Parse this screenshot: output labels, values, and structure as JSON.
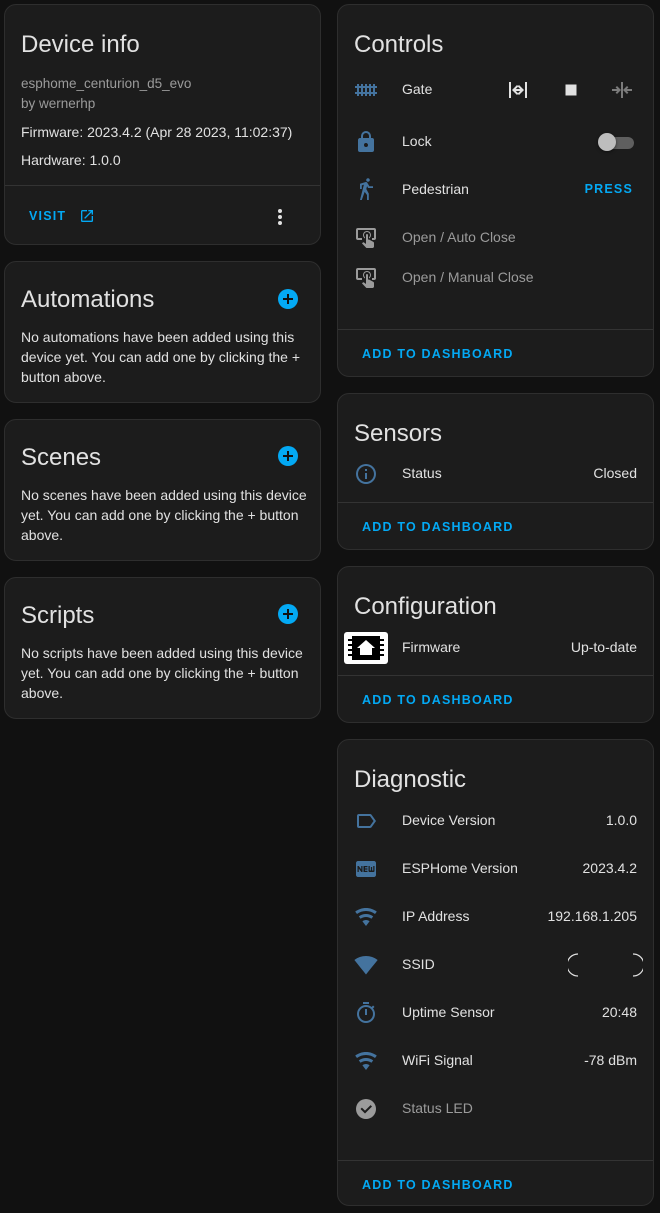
{
  "colors": {
    "accent": "#03a9f4",
    "state_icon": "#44739e",
    "background": "#111111",
    "card": "#1c1c1c"
  },
  "device_info": {
    "title": "Device info",
    "name": "esphome_centurion_d5_evo",
    "manufacturer": "by wernerhp",
    "firmware": "Firmware: 2023.4.2 (Apr 28 2023, 11:02:37)",
    "hardware": "Hardware: 1.0.0",
    "visit_label": "VISIT"
  },
  "automations": {
    "title": "Automations",
    "description": "No automations have been added using this device yet. You can add one by clicking the + button above."
  },
  "scenes": {
    "title": "Scenes",
    "description": "No scenes have been added using this device yet. You can add one by clicking the + button above."
  },
  "scripts": {
    "title": "Scripts",
    "description": "No scripts have been added using this device yet. You can add one by clicking the + button above."
  },
  "controls": {
    "title": "Controls",
    "gate_label": "Gate",
    "lock_label": "Lock",
    "lock_state": "off",
    "pedestrian_label": "Pedestrian",
    "pedestrian_action": "PRESS",
    "open_auto_close": "Open / Auto Close",
    "open_manual_close": "Open / Manual Close",
    "add_to_dashboard": "ADD TO DASHBOARD"
  },
  "sensors": {
    "title": "Sensors",
    "status_label": "Status",
    "status_value": "Closed",
    "add_to_dashboard": "ADD TO DASHBOARD"
  },
  "configuration": {
    "title": "Configuration",
    "firmware_label": "Firmware",
    "firmware_value": "Up-to-date",
    "add_to_dashboard": "ADD TO DASHBOARD"
  },
  "diagnostic": {
    "title": "Diagnostic",
    "rows": [
      {
        "label": "Device Version",
        "value": "1.0.0",
        "icon": "tag-icon"
      },
      {
        "label": "ESPHome Version",
        "value": "2023.4.2",
        "icon": "new-badge-icon"
      },
      {
        "label": "IP Address",
        "value": "192.168.1.205",
        "icon": "wifi-icon"
      },
      {
        "label": "SSID",
        "value": "",
        "icon": "wifi-strength-icon"
      },
      {
        "label": "Uptime Sensor",
        "value": "20:48",
        "icon": "timer-icon"
      },
      {
        "label": "WiFi Signal",
        "value": "-78 dBm",
        "icon": "wifi-icon"
      },
      {
        "label": "Status LED",
        "value": "",
        "icon": "check-circle-icon"
      }
    ],
    "add_to_dashboard": "ADD TO DASHBOARD"
  }
}
